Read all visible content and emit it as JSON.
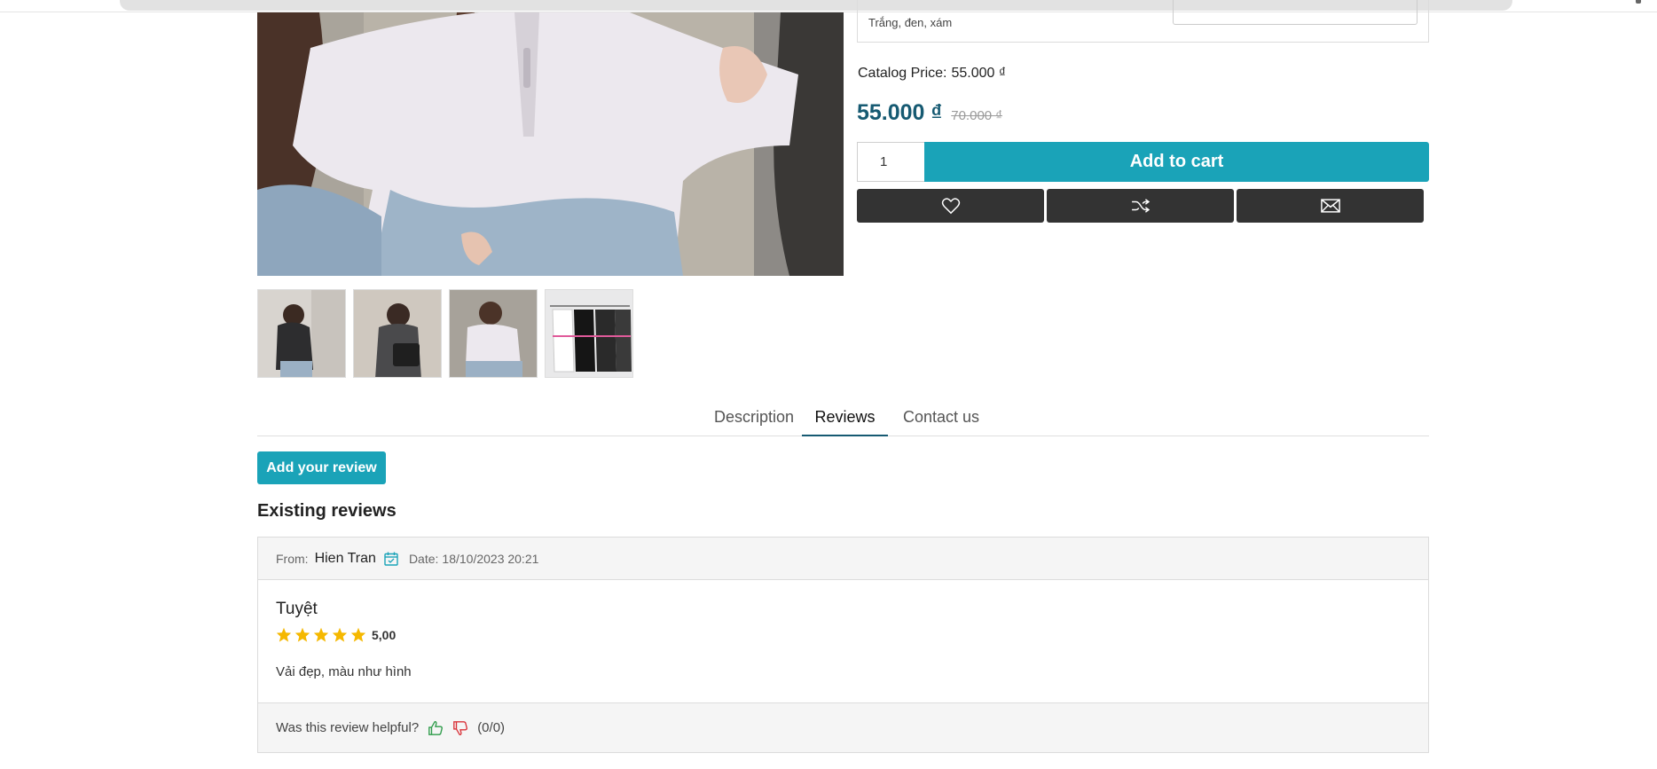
{
  "product": {
    "attribute_values": "Trắng, đen, xám",
    "catalog_price_label": "Catalog Price:",
    "catalog_price_value": "55.000 ₫",
    "price_now": "55.000 ₫",
    "price_old": "70.000 ₫",
    "quantity": "1",
    "add_to_cart": "Add to cart",
    "actions": [
      "heart-icon",
      "shuffle-icon",
      "envelope-icon"
    ]
  },
  "tabs": [
    {
      "label": "Description",
      "active": false
    },
    {
      "label": "Reviews",
      "active": true
    },
    {
      "label": "Contact us",
      "active": false
    }
  ],
  "reviews_section": {
    "add_review_label": "Add your review",
    "existing_title": "Existing reviews",
    "items": [
      {
        "from_label": "From:",
        "author": "Hien Tran",
        "date_label": "Date:",
        "date": "18/10/2023 20:21",
        "title": "Tuyệt",
        "rating": 5,
        "rating_text": "5,00",
        "text": "Vải đẹp, màu như hình",
        "helpful_label": "Was this review helpful?",
        "helpful_counts": "(0/0)"
      }
    ]
  },
  "colors": {
    "accent": "#1aa3b8",
    "price": "#165a72",
    "dark_button": "#333333",
    "star": "#f5b800",
    "thumb_up": "#2e9c4a",
    "thumb_down": "#d9333a"
  }
}
